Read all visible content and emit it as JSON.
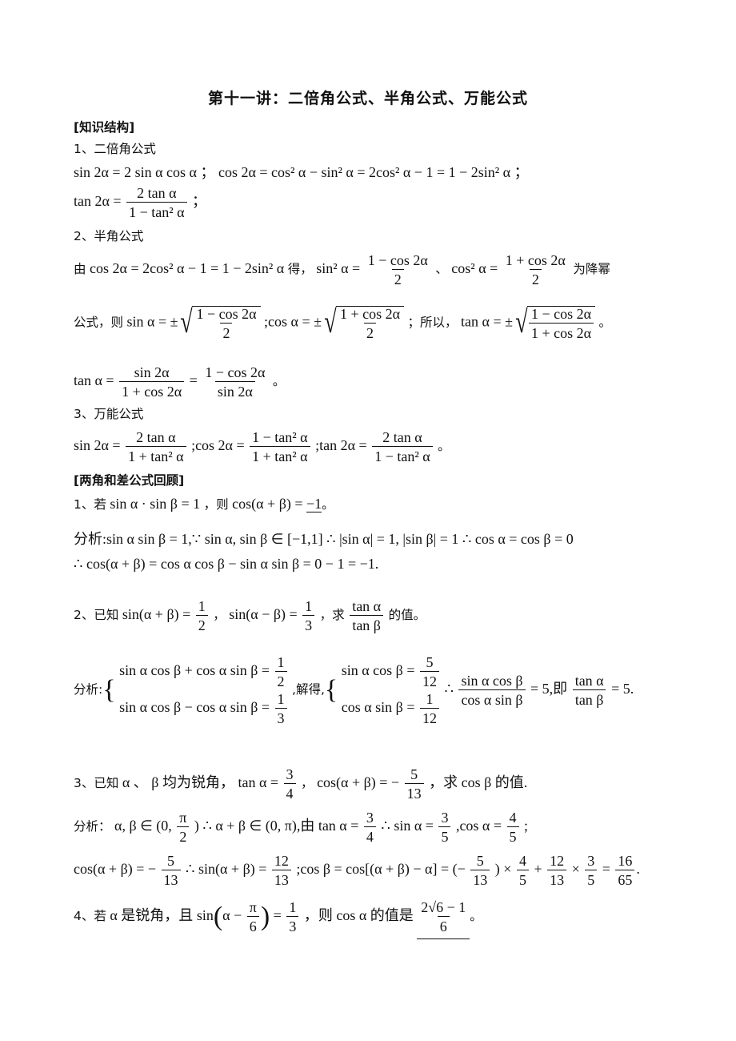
{
  "title": "第十一讲：二倍角公式、半角公式、万能公式",
  "section_knowledge": "[知识结构]",
  "s1": {
    "heading": "1、二倍角公式",
    "line1": "sin 2α = 2 sin α cos α ； cos 2α = cos² α − sin² α = 2cos² α − 1 = 1 − 2sin² α ；",
    "tan_lhs": "tan 2α =",
    "tan_num": "2 tan α",
    "tan_den": "1 − tan² α",
    "tan_end": "；"
  },
  "s2": {
    "heading": "2、半角公式",
    "intro": "由",
    "eq": "cos 2α = 2cos² α − 1 = 1 − 2sin² α",
    "de": "得，",
    "sin2_lhs": "sin² α =",
    "sin2_num": "1 − cos 2α",
    "sin2_den": "2",
    "sep": "、",
    "cos2_lhs": "cos² α =",
    "cos2_num": "1 + cos 2α",
    "cos2_den": "2",
    "tail": "为降幂",
    "line2_prefix": "公式，则",
    "sin_lhs": "sin α = ±",
    "sin_num": "1 − cos 2α",
    "sin_den": "2",
    "cos_lhs": ";cos α = ±",
    "cos_num": "1 + cos 2α",
    "cos_den": "2",
    "so": "；所以，",
    "tan_lhs": "tan α = ±",
    "tan_num": "1 − cos 2α",
    "tan_den": "1 + cos 2α",
    "period": "。",
    "tan2_lhs": "tan α =",
    "tan2_f1_num": "sin 2α",
    "tan2_f1_den": "1 + cos 2α",
    "tan2_eq": "=",
    "tan2_f2_num": "1 − cos 2α",
    "tan2_f2_den": "sin 2α"
  },
  "s3": {
    "heading": "3、万能公式",
    "sin_lhs": "sin 2α =",
    "sin_num": "2 tan α",
    "sin_den": "1 + tan² α",
    "cos_lhs": ";cos 2α =",
    "cos_num": "1 − tan² α",
    "cos_den": "1 + tan² α",
    "tan_lhs": ";tan 2α =",
    "tan_num": "2 tan α",
    "tan_den": "1 − tan² α",
    "period": "。"
  },
  "section_review": "[两角和差公式回顾]",
  "q1": {
    "prefix": "1、若",
    "cond": "sin α · sin β = 1",
    "then": "，则",
    "expr": "cos(α + β) =",
    "answer": "−1",
    "period": "。",
    "analysis1": "分析:sin α sin β = 1,∵ sin α, sin β ∈ [−1,1] ∴ |sin α| = 1, |sin β| = 1 ∴ cos α = cos β = 0",
    "analysis2": "∴ cos(α + β) = cos α cos β − sin α sin β = 0 − 1 = −1."
  },
  "q2": {
    "prefix": "2、已知",
    "e1_lhs": "sin(α + β) =",
    "e1_num": "1",
    "e1_den": "2",
    "comma": "，",
    "e2_lhs": "sin(α − β) =",
    "e2_num": "1",
    "e2_den": "3",
    "ask": "，求",
    "ask_num": "tan α",
    "ask_den": "tan β",
    "tail": "的值。",
    "analysis_label": "分析:",
    "sys1_r1_lhs": "sin α cos β + cos α sin β =",
    "sys1_r1_num": "1",
    "sys1_r1_den": "2",
    "sys1_r2_lhs": "sin α cos β − cos α sin β =",
    "sys1_r2_num": "1",
    "sys1_r2_den": "3",
    "solve": ",解得,",
    "sys2_r1_lhs": "sin α cos β =",
    "sys2_r1_num": "5",
    "sys2_r1_den": "12",
    "sys2_r2_lhs": "cos α sin β =",
    "sys2_r2_num": "1",
    "sys2_r2_den": "12",
    "therefore": "∴",
    "r_num": "sin α cos β",
    "r_den": "cos α sin β",
    "r_eq": "= 5,即",
    "r2_num": "tan α",
    "r2_den": "tan β",
    "r2_eq": "= 5."
  },
  "q3": {
    "prefix": "3、已知",
    "text1": "α 、 β 均为锐角，",
    "t_lhs": "tan α =",
    "t_num": "3",
    "t_den": "4",
    "comma": "，",
    "c_lhs": "cos(α + β) = −",
    "c_num": "5",
    "c_den": "13",
    "ask": "，求 cos β 的值.",
    "a1_label": "分析：",
    "a1_part1": "α, β ∈ (0,",
    "a1_pi_num": "π",
    "a1_pi_den": "2",
    "a1_part2": ") ∴ α + β ∈ (0, π),由 tan α =",
    "a1_t_num": "3",
    "a1_t_den": "4",
    "a1_part3": "∴ sin α =",
    "a1_s_num": "3",
    "a1_s_den": "5",
    "a1_part4": ",cos α =",
    "a1_c_num": "4",
    "a1_c_den": "5",
    "a1_end": ";",
    "a2_part1": "cos(α + β) = −",
    "a2_f1_num": "5",
    "a2_f1_den": "13",
    "a2_part2": "∴ sin(α + β) =",
    "a2_f2_num": "12",
    "a2_f2_den": "13",
    "a2_part3": ";cos β = cos[(α + β) − α] = (−",
    "a2_f3_num": "5",
    "a2_f3_den": "13",
    "a2_part4": ") ×",
    "a2_f4_num": "4",
    "a2_f4_den": "5",
    "a2_part5": "+",
    "a2_f5_num": "12",
    "a2_f5_den": "13",
    "a2_part6": "×",
    "a2_f6_num": "3",
    "a2_f6_den": "5",
    "a2_part7": "=",
    "a2_f7_num": "16",
    "a2_f7_den": "65",
    "a2_end": "."
  },
  "q4": {
    "prefix": "4、若",
    "text1": "α 是锐角，且",
    "sin": "sin",
    "alpha_minus": "α −",
    "pi_num": "π",
    "pi_den": "6",
    "eq": "=",
    "r_num": "1",
    "r_den": "3",
    "then": "，则 cos α 的值是",
    "ans_num": "2√6 − 1",
    "ans_den": "6",
    "period": "。"
  }
}
